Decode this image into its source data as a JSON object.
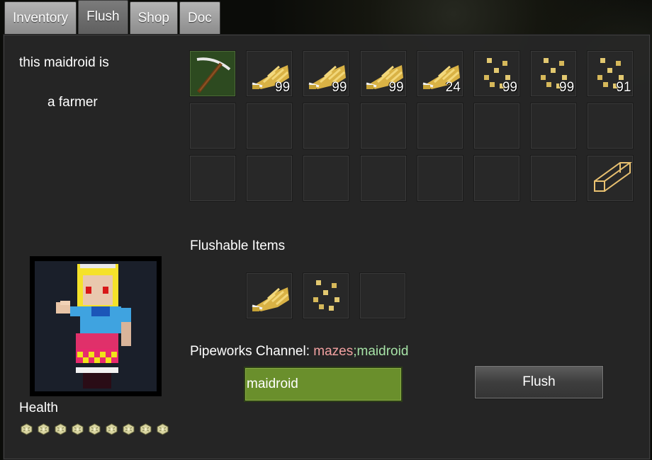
{
  "tabs": [
    {
      "label": "Inventory",
      "active": false
    },
    {
      "label": "Flush",
      "active": true
    },
    {
      "label": "Shop",
      "active": false
    },
    {
      "label": "Doc",
      "active": false
    }
  ],
  "maidroid": {
    "line1": "this maidroid is",
    "line2": "a farmer"
  },
  "inventory": [
    {
      "item": "pickaxe-icon",
      "count": ""
    },
    {
      "item": "wheat-icon",
      "count": "99"
    },
    {
      "item": "wheat-icon",
      "count": "99"
    },
    {
      "item": "wheat-icon",
      "count": "99"
    },
    {
      "item": "wheat-icon",
      "count": "24"
    },
    {
      "item": "seeds-icon",
      "count": "99"
    },
    {
      "item": "seeds-icon",
      "count": "99"
    },
    {
      "item": "seeds-icon",
      "count": "91"
    },
    {
      "item": "",
      "count": ""
    },
    {
      "item": "",
      "count": ""
    },
    {
      "item": "",
      "count": ""
    },
    {
      "item": "",
      "count": ""
    },
    {
      "item": "",
      "count": ""
    },
    {
      "item": "",
      "count": ""
    },
    {
      "item": "",
      "count": ""
    },
    {
      "item": "",
      "count": ""
    },
    {
      "item": "",
      "count": ""
    },
    {
      "item": "",
      "count": ""
    },
    {
      "item": "",
      "count": ""
    },
    {
      "item": "",
      "count": ""
    },
    {
      "item": "",
      "count": ""
    },
    {
      "item": "",
      "count": ""
    },
    {
      "item": "",
      "count": ""
    },
    {
      "item": "tube-icon",
      "count": ""
    }
  ],
  "flushable": {
    "title": "Flushable Items",
    "slots": [
      {
        "item": "wheat-icon"
      },
      {
        "item": "seeds-icon"
      },
      {
        "item": ""
      }
    ]
  },
  "pipeworks": {
    "label": "Pipeworks Channel: ",
    "channel_owner": "mazes",
    "separator": ";",
    "channel_name": "maidroid",
    "input_value": "maidroid"
  },
  "flush_button": "Flush",
  "health": {
    "label": "Health",
    "hearts": 9
  },
  "colors": {
    "channel_owner": "#f2a1a1",
    "channel_name": "#a6e2a6",
    "input_bg": "#6a8f2c",
    "tool_slot": "#2d4a20"
  }
}
